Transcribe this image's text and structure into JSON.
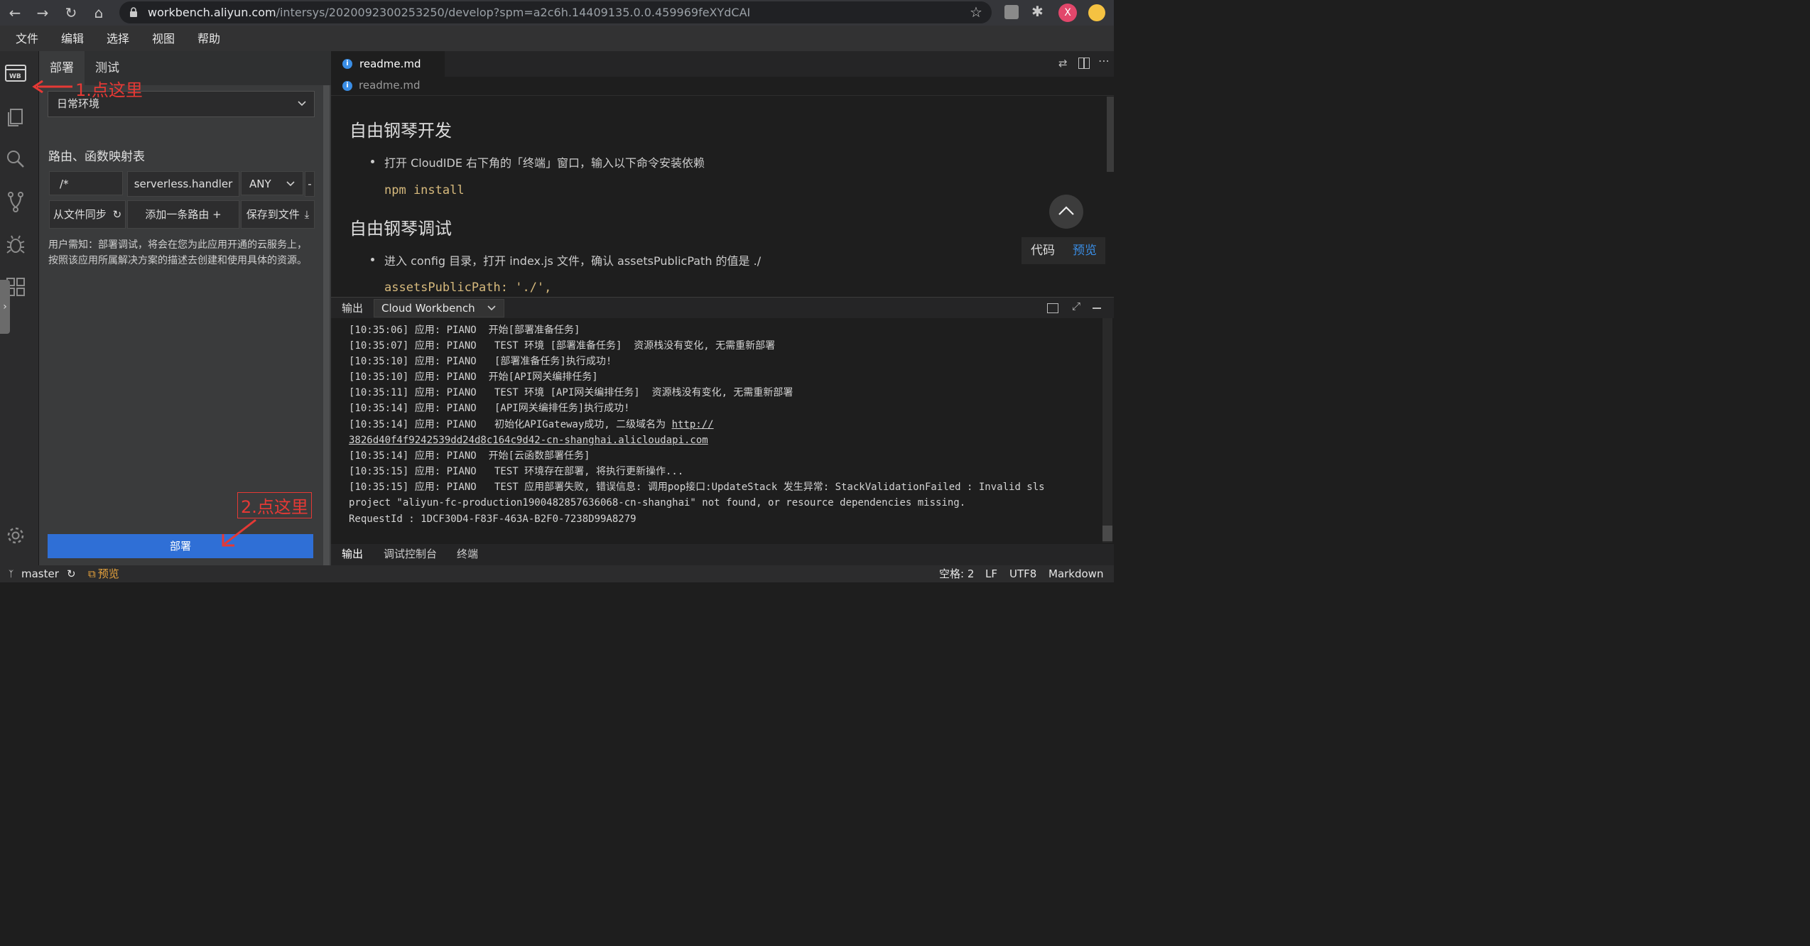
{
  "browser": {
    "url_host": "workbench.aliyun.com",
    "url_path": "/intersys/2020092300253250/develop?spm=a2c6h.14409135.0.0.459969feXYdCAI",
    "profile_initial": "X"
  },
  "menu": [
    "文件",
    "编辑",
    "选择",
    "视图",
    "帮助"
  ],
  "side": {
    "tabs": [
      "部署",
      "测试"
    ],
    "env": "日常环境",
    "route_title": "路由、函数映射表",
    "route": {
      "path": "/*",
      "handler": "serverless.handler",
      "method": "ANY",
      "remove": "-"
    },
    "sync_btn": "从文件同步",
    "add_btn": "添加一条路由 +",
    "save_btn": "保存到文件",
    "notice": "用户需知：部署调试，将会在您为此应用开通的云服务上，按照该应用所属解决方案的描述去创建和使用具体的资源。",
    "deploy_btn": "部署"
  },
  "annotations": {
    "first": "1.点这里",
    "second": "2.点这里"
  },
  "editor": {
    "tab": "readme.md",
    "breadcrumb": "readme.md",
    "h1": "自由钢琴开发",
    "li1": "打开 CloudIDE 右下角的「终端」窗口，输入以下命令安装依赖",
    "code1": "npm install",
    "h2": "自由钢琴调试",
    "li2": "进入 config 目录，打开 index.js 文件，确认 assetsPublicPath 的值是 ./",
    "code2": "assetsPublicPath: './',",
    "view_code": "代码",
    "view_preview": "预览"
  },
  "output": {
    "label": "输出",
    "channel": "Cloud Workbench",
    "lines": [
      "[10:35:06] 应用: PIANO  开始[部署准备任务]",
      "[10:35:07] 应用: PIANO   TEST 环境 [部署准备任务]  资源栈没有变化, 无需重新部署",
      "[10:35:10] 应用: PIANO   [部署准备任务]执行成功!",
      "[10:35:10] 应用: PIANO  开始[API网关编排任务]",
      "[10:35:11] 应用: PIANO   TEST 环境 [API网关编排任务]  资源栈没有变化, 无需重新部署",
      "[10:35:14] 应用: PIANO   [API网关编排任务]执行成功!"
    ],
    "line7_prefix": "[10:35:14] 应用: PIANO   初始化APIGateway成功, 二级域名为 ",
    "line7_link1": "http://",
    "line8_link2": "3826d40f4f9242539dd24d8c164c9d42-cn-shanghai.alicloudapi.com",
    "lines_after": [
      "[10:35:14] 应用: PIANO  开始[云函数部署任务]",
      "[10:35:15] 应用: PIANO   TEST 环境存在部署, 将执行更新操作...",
      "[10:35:15] 应用: PIANO   TEST 应用部署失败, 错误信息: 调用pop接口:UpdateStack 发生异常: StackValidationFailed : Invalid sls",
      "project \"aliyun-fc-production1900482857636068-cn-shanghai\" not found, or resource dependencies missing.",
      "RequestId : 1DCF30D4-F83F-463A-B2F0-7238D99A8279"
    ]
  },
  "bottom_tabs": [
    "输出",
    "调试控制台",
    "终端"
  ],
  "status": {
    "branch": "master",
    "preview": "预览",
    "spaces": "空格: 2",
    "eol": "LF",
    "encoding": "UTF8",
    "language": "Markdown"
  },
  "colors": {
    "accent": "#2f6fd6",
    "annotation": "#e53935",
    "link_preview": "#3a8ee6"
  }
}
